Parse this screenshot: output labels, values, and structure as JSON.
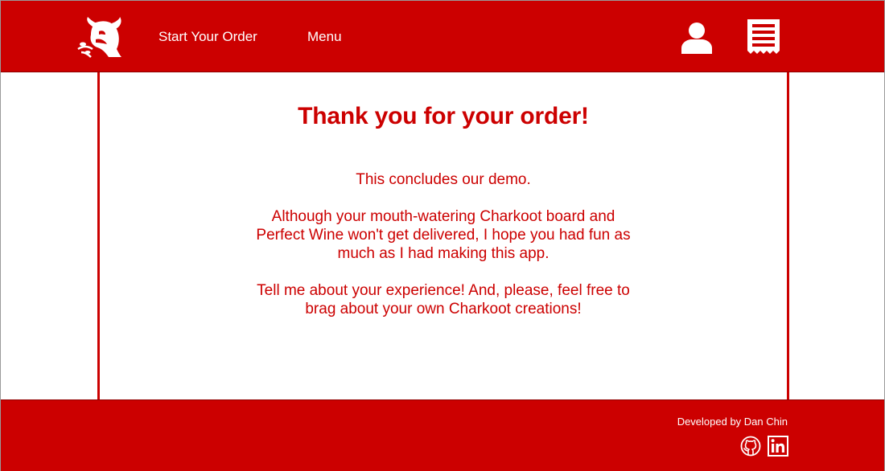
{
  "colors": {
    "brand": "#cc0000",
    "text_on_brand": "#ffffff"
  },
  "header": {
    "logo_icon": "bull-logo-icon",
    "nav": [
      {
        "label": "Start Your Order"
      },
      {
        "label": "Menu"
      }
    ],
    "user_icon": "user-icon",
    "receipt_icon": "receipt-icon"
  },
  "main": {
    "title": "Thank you for your order!",
    "paragraphs": [
      "This concludes our demo.",
      "Although your mouth-watering Charkoot board and Perfect Wine won't get delivered, I hope you had fun as much as I had making this app.",
      "Tell me about your experience! And, please, feel free to brag about your own Charkoot creations!"
    ]
  },
  "footer": {
    "credit": "Developed by Dan Chin",
    "github_icon": "github-icon",
    "linkedin_icon": "linkedin-icon"
  }
}
